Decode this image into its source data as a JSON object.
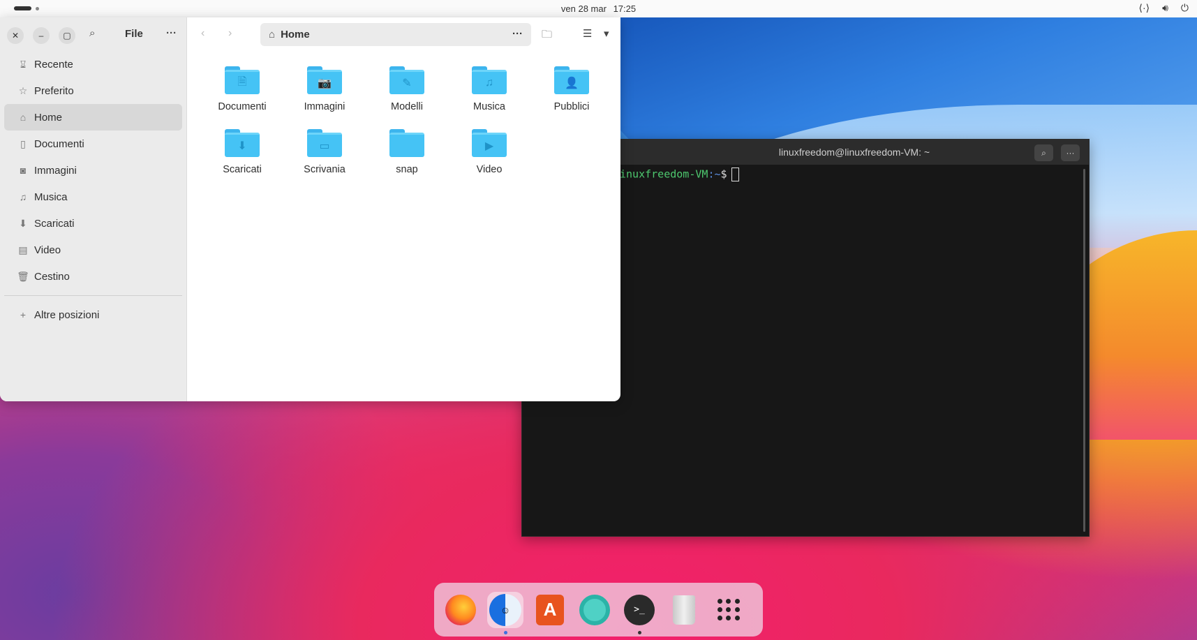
{
  "topbar": {
    "date": "ven 28 mar",
    "time": "17:25",
    "tray_icons": [
      "network-icon",
      "volume-icon",
      "power-icon"
    ]
  },
  "file_manager": {
    "sidebar_title": "File",
    "nav": [
      {
        "label": "Recente",
        "icon": "clock-icon"
      },
      {
        "label": "Preferito",
        "icon": "star-icon"
      },
      {
        "label": "Home",
        "icon": "home-icon",
        "active": true
      },
      {
        "label": "Documenti",
        "icon": "document-icon"
      },
      {
        "label": "Immagini",
        "icon": "camera-icon"
      },
      {
        "label": "Musica",
        "icon": "music-icon"
      },
      {
        "label": "Scaricati",
        "icon": "download-icon"
      },
      {
        "label": "Video",
        "icon": "film-icon"
      },
      {
        "label": "Cestino",
        "icon": "trash-icon"
      }
    ],
    "other_locations": "Altre posizioni",
    "path": "Home",
    "folders": [
      {
        "label": "Documenti",
        "glyph": "🗎"
      },
      {
        "label": "Immagini",
        "glyph": "📷"
      },
      {
        "label": "Modelli",
        "glyph": "✎"
      },
      {
        "label": "Musica",
        "glyph": "♫"
      },
      {
        "label": "Pubblici",
        "glyph": "👤"
      },
      {
        "label": "Scaricati",
        "glyph": "⬇"
      },
      {
        "label": "Scrivania",
        "glyph": "▭"
      },
      {
        "label": "snap",
        "glyph": ""
      },
      {
        "label": "Video",
        "glyph": "▶"
      }
    ]
  },
  "terminal": {
    "title": "linuxfreedom@linuxfreedom-VM: ~",
    "prompt_host": "inuxfreedom-VM",
    "prompt_path": ":~",
    "prompt_symbol": "$"
  },
  "dock": {
    "items": [
      "firefox-icon",
      "finder-icon",
      "app-store-icon",
      "help-icon",
      "terminal-icon",
      "trash-icon",
      "app-grid-icon"
    ]
  }
}
